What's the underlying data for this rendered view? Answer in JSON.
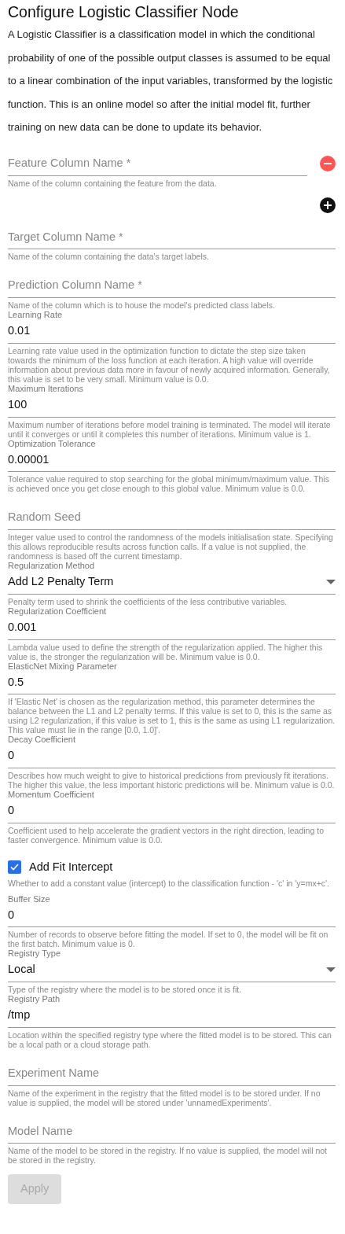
{
  "title": "Configure Logistic Classifier Node",
  "description": "A Logistic Classifier is a classification model in which the conditional probability of one of the possible output classes is assumed to be equal to a linear combination of the input variables, transformed by the logistic function. This is an online model so after the initial model fit, further training on new data can be done to update its behavior.",
  "fields": [
    {
      "kind": "text",
      "placeholder": "Feature Column Name *",
      "helper": "Name of the column containing the feature from the data.",
      "removable": true,
      "addable": true
    },
    {
      "kind": "text",
      "placeholder": "Target Column Name *",
      "helper": "Name of the column containing the data's target labels."
    },
    {
      "kind": "text",
      "placeholder": "Prediction Column Name *",
      "helper": "Name of the column which is to house the model's predicted class labels."
    },
    {
      "kind": "text",
      "label": "Learning Rate",
      "value": "0.01",
      "helper": "Learning rate value used in the optimization function to dictate the step size taken towards the minimum of the loss function at each iteration. A high value will override information about previous data more in favour of newly acquired information. Generally, this value is set to be very small. Minimum value is 0.0."
    },
    {
      "kind": "text",
      "label": "Maximum Iterations",
      "value": "100",
      "helper": "Maximum number of iterations before model training is terminated. The model will iterate until it converges or until it completes this number of iterations. Minimum value is 1."
    },
    {
      "kind": "text",
      "label": "Optimization Tolerance",
      "value": "0.00001",
      "helper": "Tolerance value required to stop searching for the global minimum/maximum value. This is achieved once you get close enough to this global value. Minimum value is 0.0."
    },
    {
      "kind": "text",
      "placeholder": "Random Seed",
      "helper": "Integer value used to control the randomness of the models initialisation state. Specifying this allows reproducible results across function calls. If a value is not supplied, the randomness is based off the current timestamp."
    },
    {
      "kind": "select",
      "label": "Regularization Method",
      "value": "Add L2 Penalty Term",
      "helper": "Penalty term used to shrink the coefficients of the less contributive variables."
    },
    {
      "kind": "text",
      "label": "Regularization Coefficient",
      "value": "0.001",
      "helper": "Lambda value used to define the strength of the regularization applied. The higher this value is, the stronger the regularization will be. Minimum value is 0.0."
    },
    {
      "kind": "text",
      "label": "ElasticNet Mixing Parameter",
      "value": "0.5",
      "helper": "If 'Elastic Net' is chosen as the regularization method, this parameter determines the balance between the L1 and L2 penalty terms. If this value is set to 0, this is the same as using L2 regularization, if this value is set to 1, this is the same as using L1 regularization. This value must lie in the range [0.0, 1.0]'."
    },
    {
      "kind": "text",
      "label": "Decay Coefficient",
      "value": "0",
      "helper": "Describes how much weight to give to historical predictions from previously fit iterations. The higher this value, the less important historic predictions will be. Minimum value is 0.0."
    },
    {
      "kind": "text",
      "label": "Momentum Coefficient",
      "value": "0",
      "helper": "Coefficient used to help accelerate the gradient vectors in the right direction, leading to faster convergence. Minimum value is 0.0."
    },
    {
      "kind": "checkbox",
      "label": "Add Fit Intercept",
      "checked": true,
      "helper": "Whether to add a constant value (intercept) to the classification function - 'c' in 'y=mx+c'."
    },
    {
      "kind": "text",
      "label": "Buffer Size",
      "value": "0",
      "helper": "Number of records to observe before fitting the model. If set to 0, the model will be fit on the first batch. Minimum value is 0."
    },
    {
      "kind": "select",
      "label": "Registry Type",
      "value": "Local",
      "helper": "Type of the registry where the model is to be stored once it is fit."
    },
    {
      "kind": "text",
      "label": "Registry Path",
      "value": "/tmp",
      "helper": "Location within the specified registry type where the fitted model is to be stored. This can be a local path or a cloud storage path."
    },
    {
      "kind": "text",
      "placeholder": "Experiment Name",
      "helper": "Name of the experiment in the registry that the fitted model is to be stored under. If no value is supplied, the model will be stored under 'unnamedExperiments'."
    },
    {
      "kind": "text",
      "placeholder": "Model Name",
      "helper": "Name of the model to be stored in the registry. If no value is supplied, the model will not be stored in the registry."
    }
  ],
  "apply": {
    "label": "Apply",
    "disabled": true
  }
}
